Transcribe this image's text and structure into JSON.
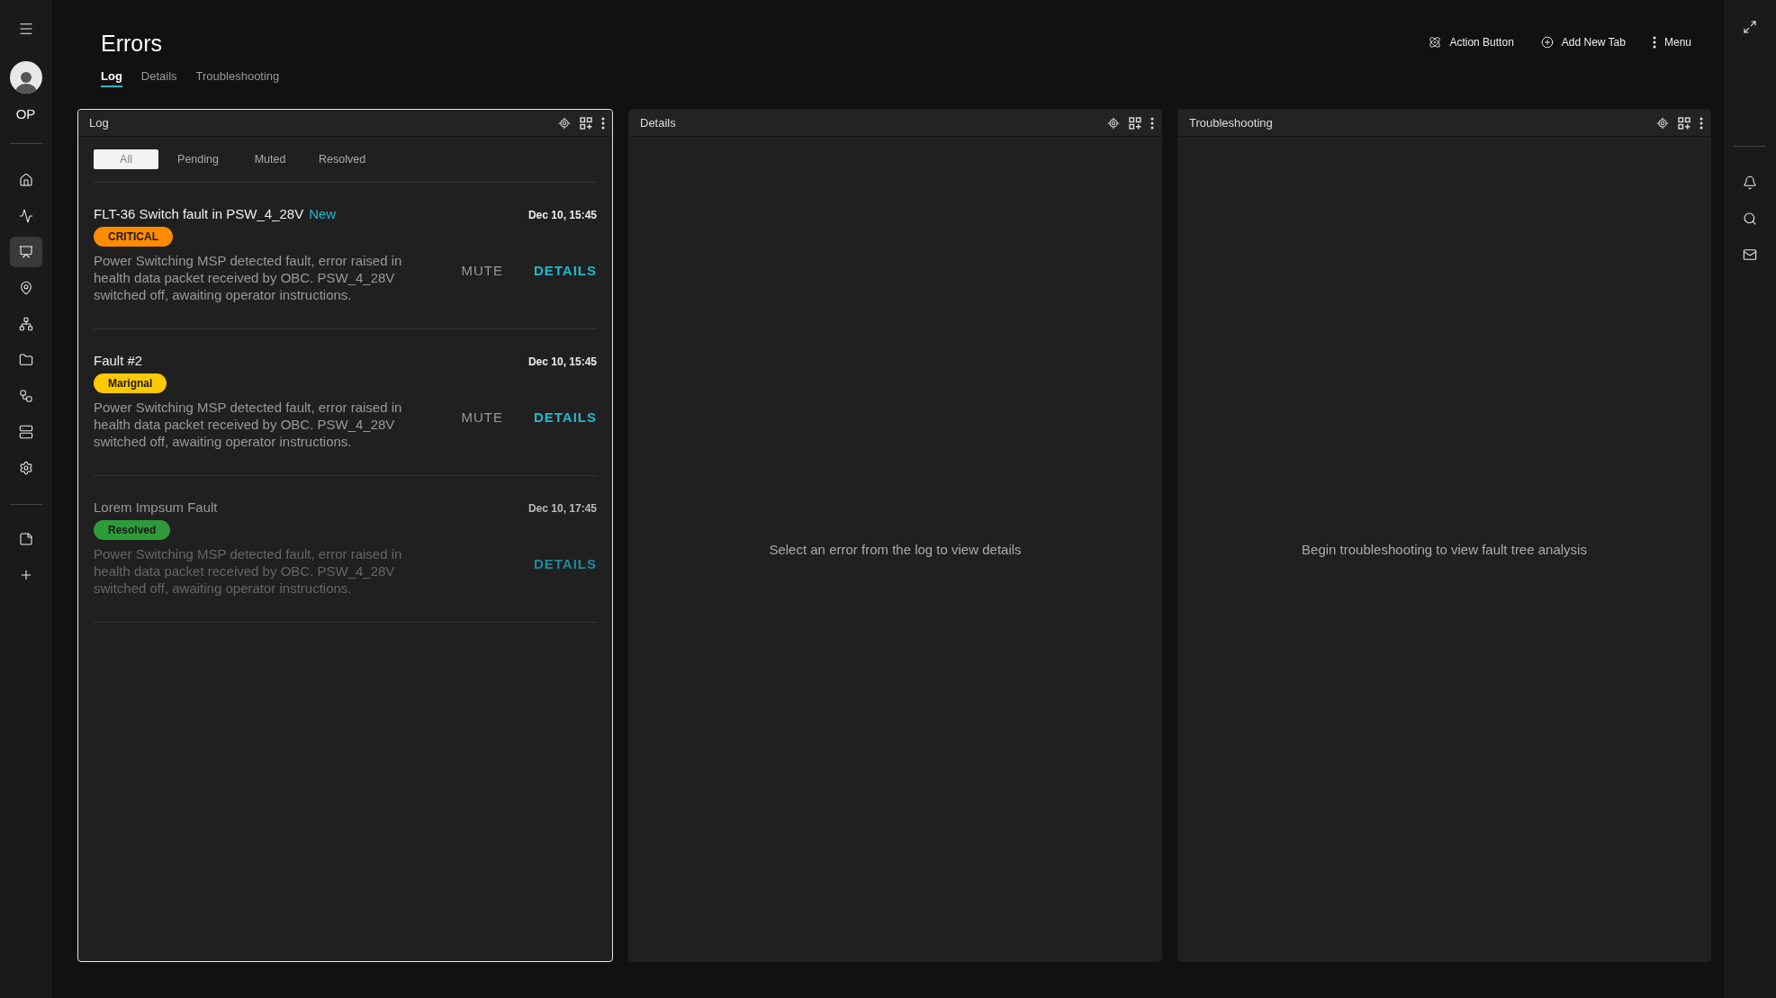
{
  "sidebar": {
    "user_initials": "OP",
    "items": [
      {
        "selected": false
      },
      {
        "selected": false
      },
      {
        "selected": true
      },
      {
        "selected": false
      },
      {
        "selected": false
      },
      {
        "selected": false
      },
      {
        "selected": false
      },
      {
        "selected": false
      },
      {
        "selected": false
      }
    ]
  },
  "header": {
    "title": "Errors",
    "tabs": [
      {
        "label": "Log",
        "selected": true
      },
      {
        "label": "Details",
        "selected": false
      },
      {
        "label": "Troubleshooting",
        "selected": false
      }
    ],
    "actions": [
      {
        "label": "Action Button"
      },
      {
        "label": "Add New Tab"
      },
      {
        "label": "Menu"
      }
    ]
  },
  "panels": [
    {
      "title": "Log",
      "focused": true,
      "kind": "log",
      "filters": [
        {
          "label": "All",
          "selected": true
        },
        {
          "label": "Pending",
          "selected": false
        },
        {
          "label": "Muted",
          "selected": false
        },
        {
          "label": "Resolved",
          "selected": false
        }
      ],
      "entries": [
        {
          "title": "FLT-36 Switch fault in PSW_4_28V",
          "tag": "New",
          "badge": "CRITICAL",
          "color": "#ff8c00",
          "time": "Dec 10, 15:45",
          "description": "Power Switching MSP detected fault, error raised in health data packet received by OBC. PSW_4_28V switched off, awaiting operator instructions.",
          "mute": "MUTE",
          "details": "DETAILS",
          "resolved": false
        },
        {
          "title": "Fault #2",
          "badge": "Marignal",
          "color": "#ffc800",
          "time": "Dec 10, 15:45",
          "description": "Power Switching MSP detected fault, error raised in health data packet received by OBC. PSW_4_28V switched off, awaiting operator instructions.",
          "mute": "MUTE",
          "details": "DETAILS",
          "resolved": false
        },
        {
          "title": "Lorem Impsum Fault",
          "badge": "Resolved",
          "color": "#2e9a3a",
          "time": "Dec 10, 17:45",
          "description": "Power Switching MSP detected fault, error raised in health data packet received by OBC. PSW_4_28V switched off, awaiting operator instructions.",
          "details": "DETAILS",
          "resolved": true
        }
      ]
    },
    {
      "title": "Details",
      "focused": false,
      "kind": "empty",
      "message": "Select an error from the log to view details"
    },
    {
      "title": "Troubleshooting",
      "focused": false,
      "kind": "empty",
      "message": "Begin troubleshooting to view fault tree analysis"
    }
  ]
}
